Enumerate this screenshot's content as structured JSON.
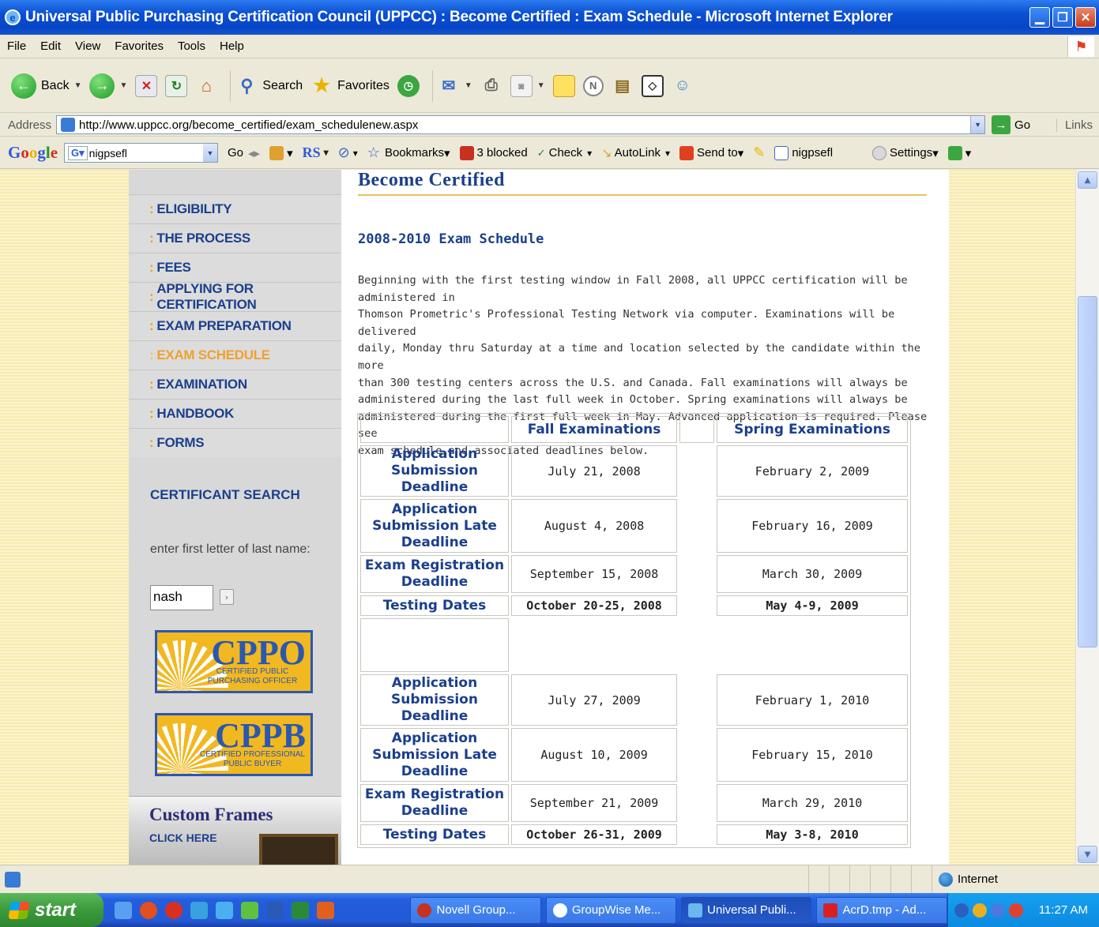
{
  "window": {
    "title": "Universal Public Purchasing Certification Council (UPPCC) : Become Certified : Exam Schedule - Microsoft Internet Explorer"
  },
  "menu": [
    "File",
    "Edit",
    "View",
    "Favorites",
    "Tools",
    "Help"
  ],
  "toolbar": {
    "back": "Back",
    "search": "Search",
    "favorites": "Favorites"
  },
  "address": {
    "label": "Address",
    "url": "http://www.uppcc.org/become_certified/exam_schedulenew.aspx",
    "go": "Go",
    "links": "Links"
  },
  "google": {
    "logo": [
      "G",
      "o",
      "o",
      "g",
      "l",
      "e"
    ],
    "field_value": "nigpsefl",
    "go": "Go",
    "rs": "RS",
    "bookmarks": "Bookmarks",
    "blocked": "3 blocked",
    "check": "Check",
    "autolink": "AutoLink",
    "sendto": "Send to",
    "user": "nigpsefl",
    "settings": "Settings"
  },
  "sidebar": {
    "items": [
      {
        "label": "ELIGIBILITY"
      },
      {
        "label": "THE PROCESS"
      },
      {
        "label": "FEES"
      },
      {
        "label": "APPLYING FOR CERTIFICATION"
      },
      {
        "label": "EXAM PREPARATION"
      },
      {
        "label": "EXAM SCHEDULE"
      },
      {
        "label": "EXAMINATION"
      },
      {
        "label": "HANDBOOK"
      },
      {
        "label": "FORMS"
      }
    ],
    "certificant_search": "CERTIFICANT SEARCH",
    "search_prompt": "enter first letter of last name:",
    "search_value": "nash",
    "cppo": {
      "acronym": "CPPO",
      "line1": "CERTIFIED PUBLIC",
      "line2": "PURCHASING OFFICER"
    },
    "cppb": {
      "acronym": "CPPB",
      "line1": "CERTIFIED PROFESSIONAL",
      "line2": "PUBLIC BUYER"
    },
    "frames": {
      "title": "Custom Frames",
      "link": "CLICK HERE"
    }
  },
  "content": {
    "heading": "Become Certified",
    "schedule_title": "2008-2010 Exam Schedule",
    "intro_lines": [
      "Beginning with the first testing window in Fall 2008, all UPPCC certification will be administered in",
      "Thomson Prometric's Professional Testing Network via computer. Examinations will be delivered",
      "daily, Monday thru Saturday at a time and location selected by the candidate within the more",
      "than 300 testing centers across the U.S. and Canada. Fall examinations will always be",
      "administered during the last full week in October. Spring examinations will always be",
      "administered during the first full week in May. Advanced application is required. Please see",
      "exam schedule and associated deadlines below."
    ],
    "table": {
      "fall_header": "Fall Examinations",
      "spring_header": "Spring Examinations",
      "block1": [
        {
          "label": [
            "Application",
            "Submission Deadline"
          ],
          "fall": "July 21, 2008",
          "spring": "February 2, 2009"
        },
        {
          "label": [
            "Application",
            "Submission Late",
            "Deadline"
          ],
          "fall": "August 4, 2008",
          "spring": "February 16, 2009"
        },
        {
          "label": [
            "Exam Registration",
            "Deadline"
          ],
          "fall": "September 15, 2008",
          "spring": "March 30, 2009"
        },
        {
          "label": [
            "Testing Dates"
          ],
          "fall": "October 20-25, 2008",
          "spring": "May 4-9, 2009",
          "bold": true
        }
      ],
      "block2": [
        {
          "label": [
            "Application",
            "Submission Deadline"
          ],
          "fall": "July 27, 2009",
          "spring": "February 1, 2010"
        },
        {
          "label": [
            "Application",
            "Submission Late",
            "Deadline"
          ],
          "fall": "August 10, 2009",
          "spring": "February 15, 2010"
        },
        {
          "label": [
            "Exam Registration",
            "Deadline"
          ],
          "fall": "September 21, 2009",
          "spring": "March 29, 2010"
        },
        {
          "label": [
            "Testing Dates"
          ],
          "fall": "October 26-31, 2009",
          "spring": "May 3-8, 2010",
          "bold": true
        }
      ]
    }
  },
  "status": {
    "zone": "Internet"
  },
  "taskbar": {
    "start": "start",
    "tasks": [
      {
        "label": "Novell Group..."
      },
      {
        "label": "GroupWise Me..."
      },
      {
        "label": "Universal Publi..."
      },
      {
        "label": "AcrD.tmp - Ad..."
      }
    ],
    "clock": "11:27 AM"
  },
  "colors": {
    "accent": "#1B3F8C",
    "active_nav": "#F0A030",
    "page_bg": "#F7EBB0",
    "titlebar": "#0A4FD2"
  }
}
